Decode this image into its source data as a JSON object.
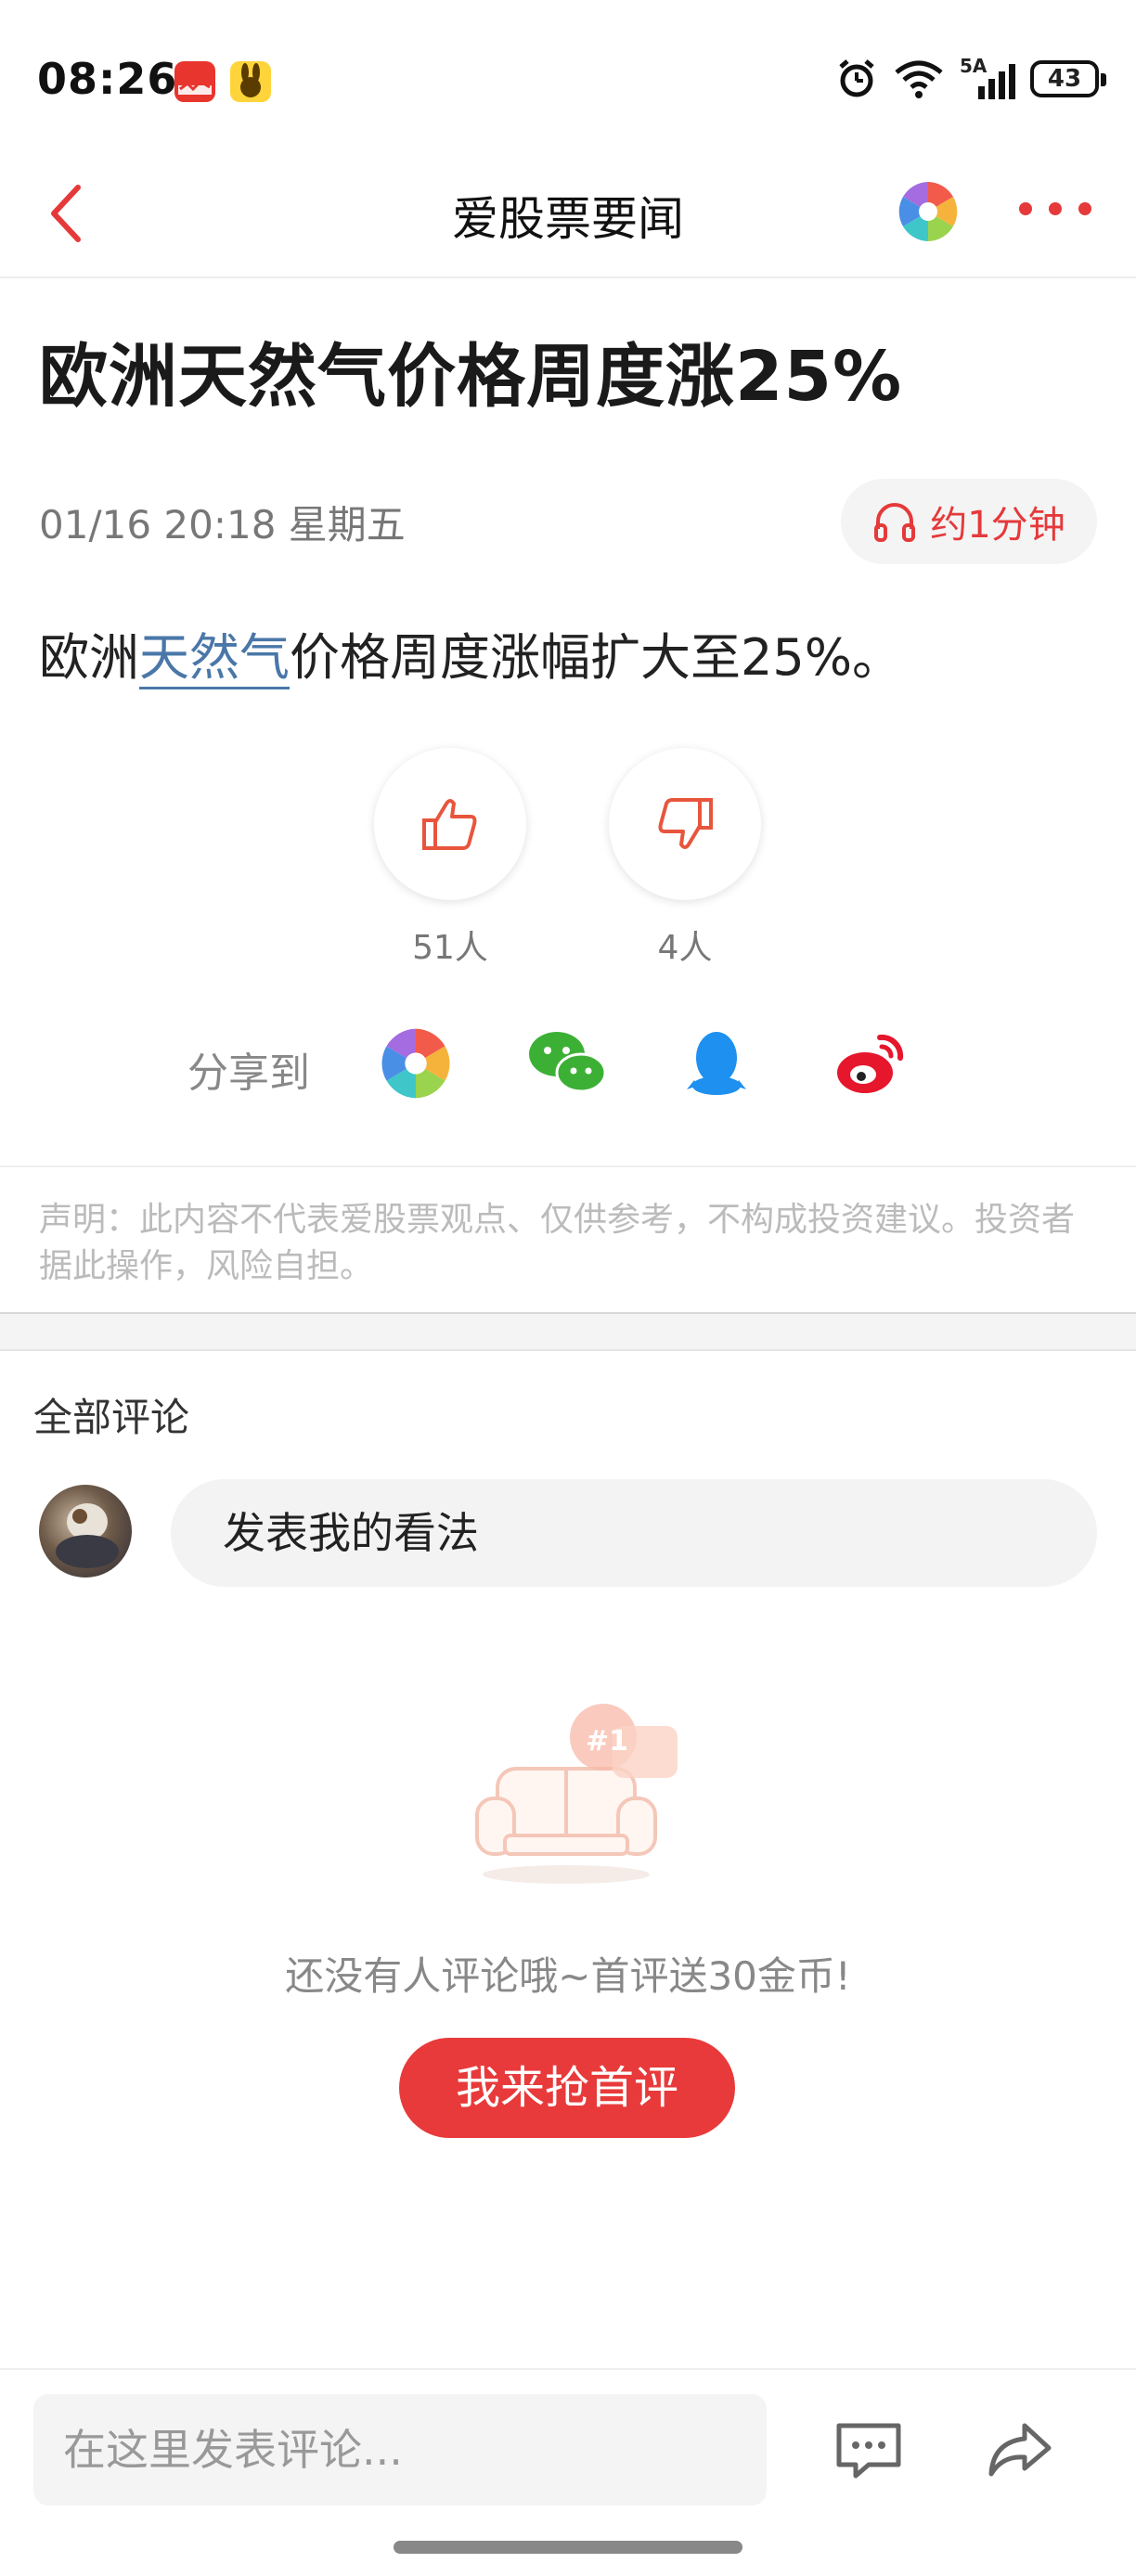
{
  "status_bar": {
    "time": "08:26",
    "network": "5A",
    "battery": "43",
    "icons": [
      "app-badge-aigupiao-icon",
      "app-badge-rabbit-icon",
      "alarm-icon",
      "wifi-icon",
      "signal-icon",
      "battery-icon"
    ]
  },
  "nav": {
    "title": "爱股票要闻",
    "back_icon": "chevron-left-icon",
    "logo_icon": "aperture-logo-icon",
    "more_icon": "more-dots-icon"
  },
  "article": {
    "headline": "欧洲天然气价格周度涨25%",
    "datetime": "01/16 20:18 星期五",
    "listen_label": "约1分钟",
    "body_prefix": "欧洲",
    "body_link": "天然气",
    "body_suffix": "价格周度涨幅扩大至25%。"
  },
  "votes": {
    "up_count": "51人",
    "down_count": "4人"
  },
  "share": {
    "label": "分享到",
    "targets": [
      "aigupiao-icon",
      "wechat-icon",
      "qq-icon",
      "weibo-icon"
    ]
  },
  "disclaimer": "声明：此内容不代表爱股票观点、仅供参考，不构成投资建议。投资者据此操作，风险自担。",
  "comments": {
    "title": "全部评论",
    "input_prompt": "发表我的看法",
    "empty_badge": "#1",
    "empty_text": "还没有人评论哦~首评送30金币!",
    "first_button": "我来抢首评"
  },
  "bottom_bar": {
    "input_placeholder": "在这里发表评论..."
  },
  "colors": {
    "accent": "#e83a3a",
    "link": "#4a77a8"
  }
}
